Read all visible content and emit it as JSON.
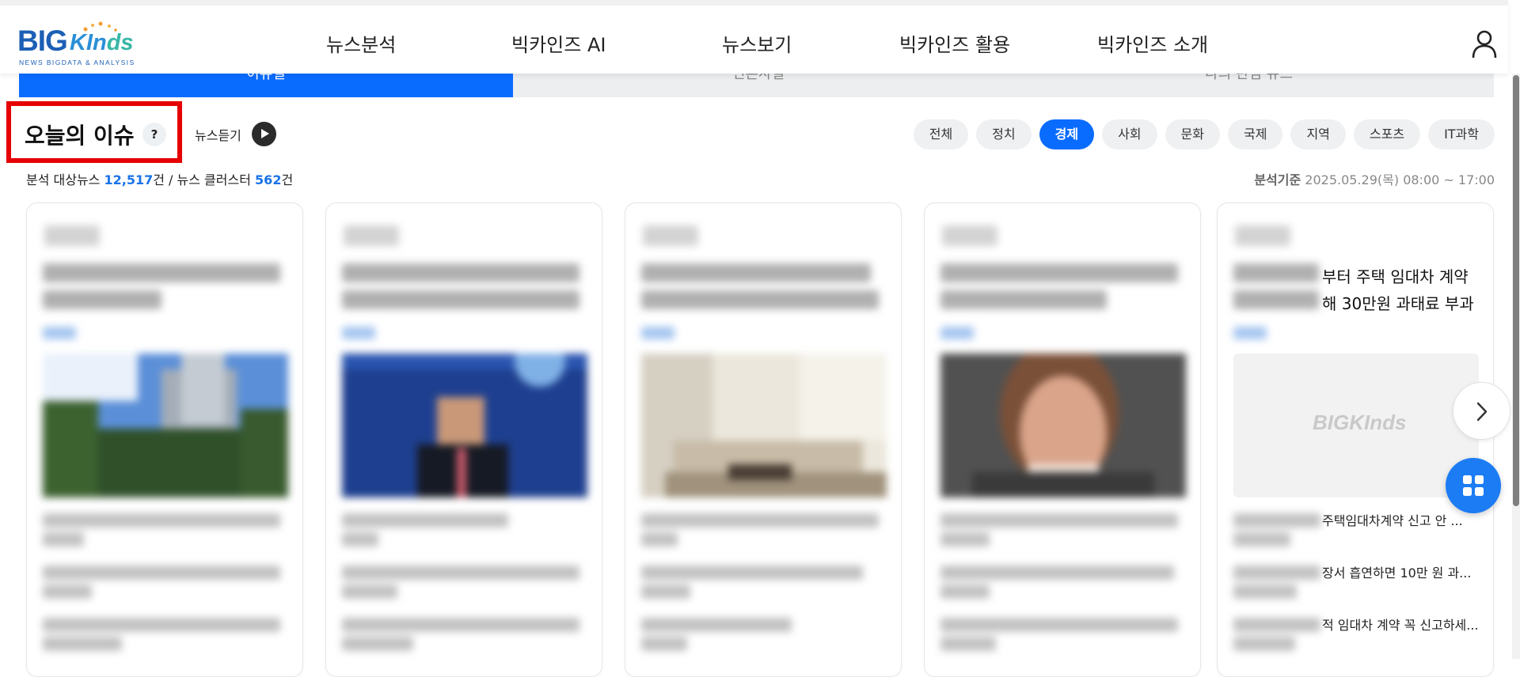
{
  "logo": {
    "big": "BIG",
    "kinds_main": "KIn",
    "kinds_tail": "ds",
    "subtitle": "NEWS BIGDATA & ANALYSIS"
  },
  "nav": {
    "items": [
      "뉴스분석",
      "빅카인즈 AI",
      "뉴스보기",
      "빅카인즈 활용",
      "빅카인즈 소개"
    ]
  },
  "tabs": [
    "이슈별",
    "언론사별",
    "나의 관심 뉴스"
  ],
  "issue": {
    "title": "오늘의 이슈",
    "help_label": "?",
    "listen_label": "뉴스듣기"
  },
  "categories": {
    "items": [
      "전체",
      "정치",
      "경제",
      "사회",
      "문화",
      "국제",
      "지역",
      "스포츠",
      "IT과학"
    ],
    "selected": "경제"
  },
  "stats": {
    "news_label": "분석 대상뉴스",
    "news_count": "12,517",
    "unit1": "건 / 뉴스 클러스터",
    "cluster_count": "562",
    "unit2": "건",
    "basis_label": "분석기준",
    "basis_value": "2025.05.29(목) 08:00 ~ 17:00"
  },
  "last_card": {
    "title_line1": "부터 주택 임대차 계약",
    "title_line2": "해 30만원 과태료 부과",
    "placeholder_logo": "BIGKInds",
    "items": [
      "주택임대차계약 신고 안 ...",
      "장서 흡연하면 10만 원 과...",
      "적 임대차 계약 꼭 신고하세..."
    ]
  },
  "colors": {
    "accent": "#0a6cff",
    "highlight_box": "#e60000",
    "count_blue": "#1a73e8"
  },
  "icons": {
    "user": "user-icon",
    "play": "play-icon",
    "next": "chevron-right-icon",
    "menu": "grid-icon"
  }
}
